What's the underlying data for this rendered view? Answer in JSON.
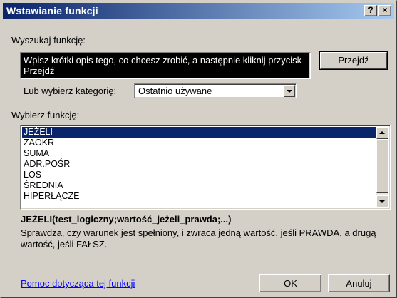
{
  "window": {
    "title": "Wstawianie funkcji",
    "help_button": "?",
    "close_button": "×"
  },
  "search": {
    "label": "Wyszukaj funkcję:",
    "value": "Wpisz krótki opis tego, co chcesz zrobić, a następnie kliknij przycisk Przejdź",
    "go_button": "Przejdź"
  },
  "category": {
    "label": "Lub wybierz kategorię:",
    "selected": "Ostatnio używane"
  },
  "functions": {
    "label": "Wybierz funkcję:",
    "items": [
      "JEŻELI",
      "ZAOKR",
      "SUMA",
      "ADR.POŚR",
      "LOS",
      "ŚREDNIA",
      "HIPERŁĄCZE"
    ],
    "selected_index": 0
  },
  "details": {
    "signature": "JEŻELI(test_logiczny;wartość_jeżeli_prawda;...)",
    "description": "Sprawdza, czy warunek jest spełniony, i zwraca jedną wartość, jeśli PRAWDA, a drugą wartość, jeśli FAŁSZ."
  },
  "footer": {
    "help_link": "Pomoc dotycząca tej funkcji",
    "ok_button": "OK",
    "cancel_button": "Anuluj"
  },
  "colors": {
    "title_start": "#0a246a",
    "title_end": "#a6caf0",
    "selection": "#0a246a",
    "face": "#d4d0c8",
    "link": "#0000ff"
  },
  "icons": {
    "close": "close-icon",
    "help": "help-icon",
    "dropdown": "chevron-down-icon",
    "scroll_up": "scroll-up-icon",
    "scroll_down": "scroll-down-icon"
  }
}
